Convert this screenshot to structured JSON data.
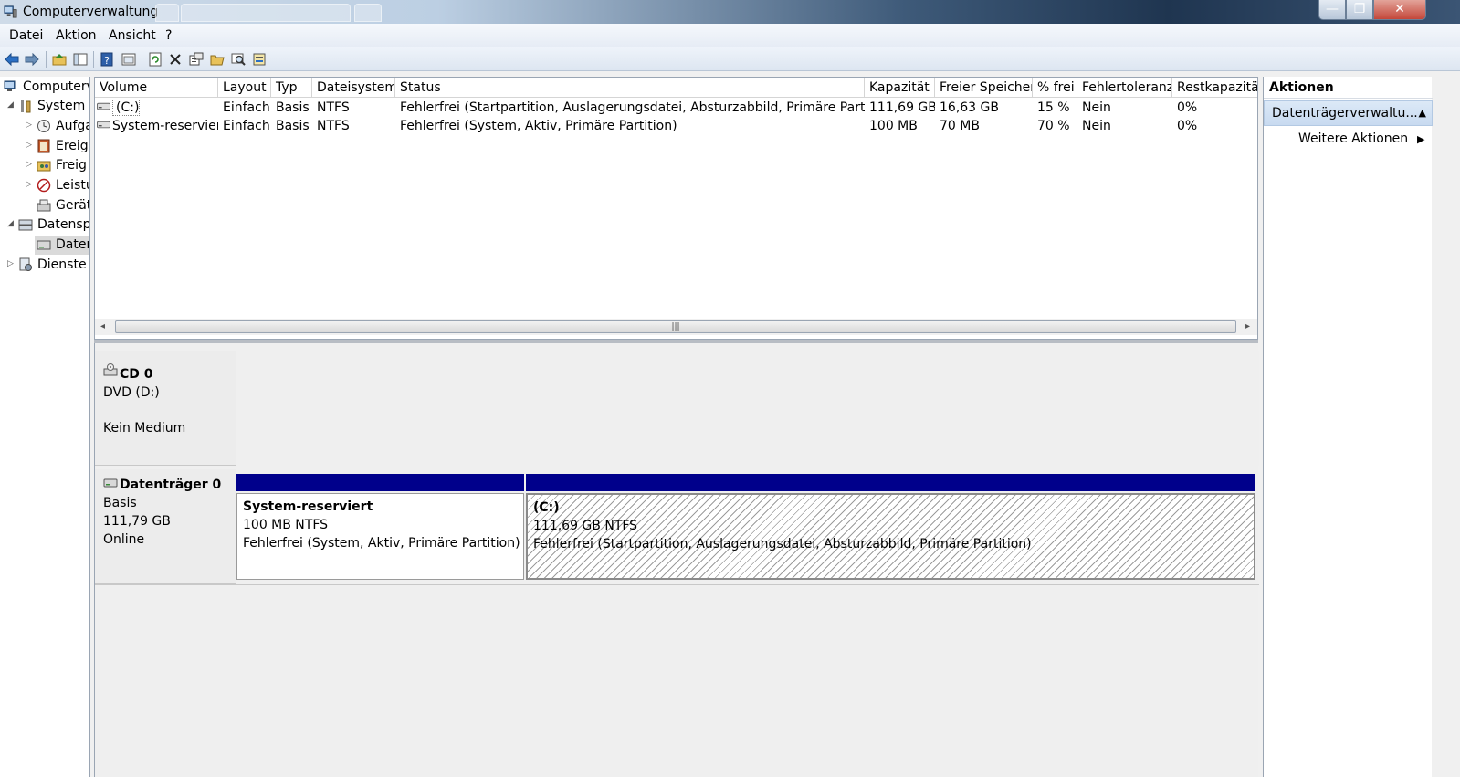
{
  "window": {
    "title": "Computerverwaltung",
    "controls": {
      "minimize": "—",
      "maximize": "❐",
      "close": "✕"
    }
  },
  "menu": [
    "Datei",
    "Aktion",
    "Ansicht",
    "?"
  ],
  "toolbar": {
    "icons": [
      "back-icon",
      "forward-icon",
      "up-folder-icon",
      "show-hide-tree-icon",
      "help-icon",
      "console-view-icon",
      "refresh-icon",
      "delete-icon",
      "properties-icon",
      "open-icon",
      "search-icon",
      "disk-properties-icon"
    ]
  },
  "tree": {
    "items": [
      {
        "label": "Computerv",
        "level": 0,
        "expander": "",
        "icon": "computer-icon"
      },
      {
        "label": "System",
        "level": 1,
        "expander": "◢",
        "icon": "tools-icon"
      },
      {
        "label": "Aufga",
        "level": 2,
        "expander": "▷",
        "icon": "clock-icon"
      },
      {
        "label": "Ereig",
        "level": 2,
        "expander": "▷",
        "icon": "event-viewer-icon"
      },
      {
        "label": "Freig",
        "level": 2,
        "expander": "▷",
        "icon": "shared-folder-icon"
      },
      {
        "label": "Leistu",
        "level": 2,
        "expander": "▷",
        "icon": "performance-icon"
      },
      {
        "label": "Gerät",
        "level": 2,
        "expander": "",
        "icon": "device-manager-icon"
      },
      {
        "label": "Datensp",
        "level": 1,
        "expander": "◢",
        "icon": "storage-icon"
      },
      {
        "label": "Datenträgerverwaltung",
        "level": 2,
        "expander": "",
        "icon": "disk-management-icon",
        "selected": true
      },
      {
        "label": "Dienste",
        "level": 1,
        "expander": "▷",
        "icon": "services-icon"
      }
    ]
  },
  "volume_list": {
    "columns": [
      "Volume",
      "Layout",
      "Typ",
      "Dateisystem",
      "Status",
      "Kapazität",
      "Freier Speicher",
      "% frei",
      "Fehlertoleranz",
      "Restkapazität"
    ],
    "rows": [
      [
        "(C:)",
        "Einfach",
        "Basis",
        "NTFS",
        "Fehlerfrei (Startpartition, Auslagerungsdatei, Absturzabbild, Primäre Partition)",
        "111,69 GB",
        "16,63 GB",
        "15 %",
        "Nein",
        "0%"
      ],
      [
        "System-reserviert",
        "Einfach",
        "Basis",
        "NTFS",
        "Fehlerfrei (System, Aktiv, Primäre Partition)",
        "100 MB",
        "70 MB",
        "70 %",
        "Nein",
        "0%"
      ]
    ],
    "scrollbar": {
      "left_arrow": "◂",
      "right_arrow": "▸",
      "grip": "|||"
    }
  },
  "disks": [
    {
      "name": "CD 0",
      "lines": [
        "DVD (D:)",
        "",
        "Kein Medium"
      ],
      "partitions": []
    },
    {
      "name": "Datenträger 0",
      "lines": [
        "Basis",
        "111,79 GB",
        "Online"
      ],
      "partitions": [
        {
          "name": "System-reserviert",
          "size": "100 MB NTFS",
          "status": "Fehlerfrei (System, Aktiv, Primäre Partition)",
          "selected": false
        },
        {
          "name": "(C:)",
          "size": "111,69 GB NTFS",
          "status": "Fehlerfrei (Startpartition, Auslagerungsdatei, Absturzabbild, Primäre Partition)",
          "selected": true
        }
      ]
    }
  ],
  "actions": {
    "title": "Aktionen",
    "section": "Datenträgerverwaltu...",
    "section_caret": "▲",
    "more": "Weitere Aktionen",
    "more_arrow": "▶"
  },
  "colors": {
    "partition_bar": "#00008b",
    "selection": "#cde1f7"
  }
}
